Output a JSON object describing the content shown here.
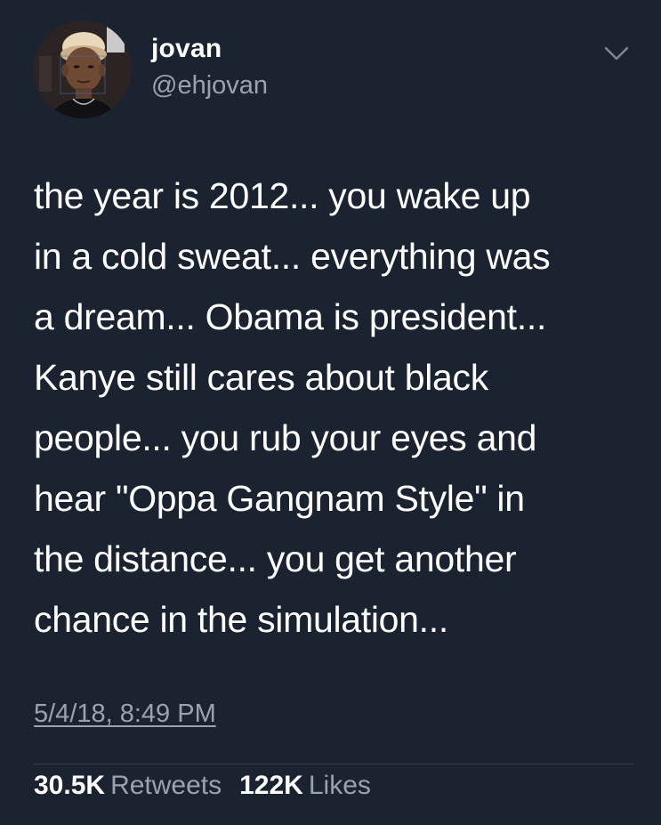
{
  "user": {
    "name": "jovan",
    "handle": "@ehjovan",
    "avatar_icon": "profile-photo"
  },
  "menu": {
    "icon": "chevron-down-icon"
  },
  "tweet": {
    "text": "the year is 2012... you wake up\nin a cold sweat... everything was\na dream... Obama is president...\nKanye still cares about black\npeople... you rub your eyes and\nhear \"Oppa Gangnam Style\" in\nthe distance... you get another\nchance in the simulation...",
    "timestamp": "5/4/18, 8:49 PM"
  },
  "stats": {
    "retweets_count": "30.5K",
    "retweets_label": "Retweets",
    "likes_count": "122K",
    "likes_label": "Likes"
  },
  "colors": {
    "background": "#1b2330",
    "text_primary": "#ffffff",
    "text_secondary": "#9aa3ad",
    "divider": "#37414f"
  }
}
